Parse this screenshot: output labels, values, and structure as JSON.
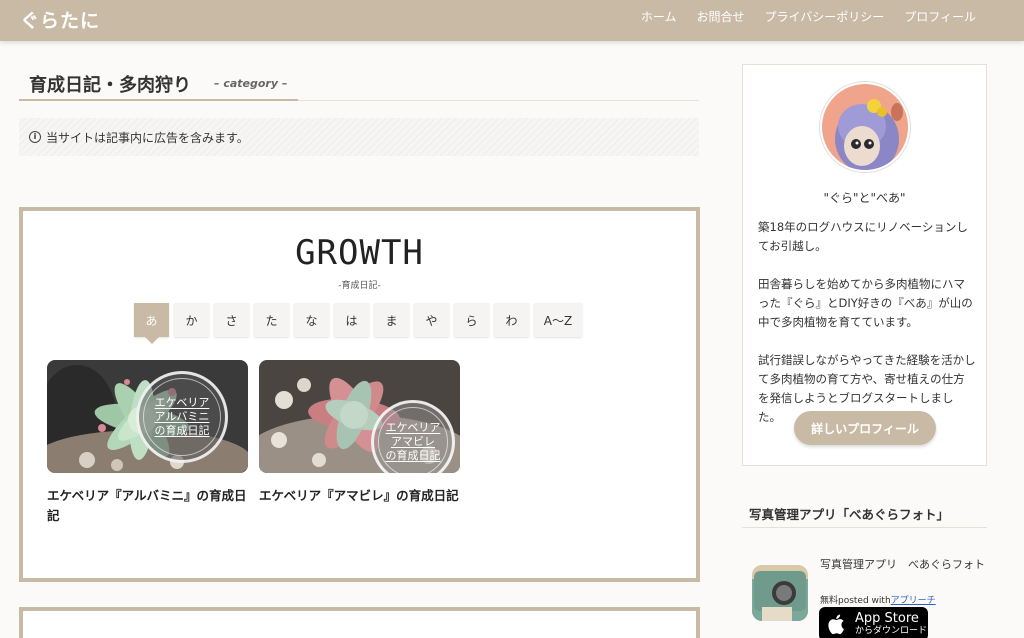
{
  "site": {
    "title": "ぐらたに"
  },
  "nav": [
    {
      "label": "ホーム"
    },
    {
      "label": "お問合せ"
    },
    {
      "label": "プライバシーポリシー"
    },
    {
      "label": "プロフィール"
    }
  ],
  "category": {
    "title": "育成日記・多肉狩り",
    "subtitle": "– category –"
  },
  "notice": {
    "icon": "info-icon",
    "text": "当サイトは記事内に広告を含みます。"
  },
  "growth": {
    "title": "GROWTH",
    "subtitle": "-育成日記-",
    "kana_tabs": [
      {
        "label": "あ",
        "active": true
      },
      {
        "label": "か"
      },
      {
        "label": "さ"
      },
      {
        "label": "た"
      },
      {
        "label": "な"
      },
      {
        "label": "は"
      },
      {
        "label": "ま"
      },
      {
        "label": "や"
      },
      {
        "label": "ら"
      },
      {
        "label": "わ"
      },
      {
        "label": "A〜Z"
      }
    ],
    "cards": [
      {
        "badge": [
          "エケベリア",
          "アルバミニ",
          "の育成日記"
        ],
        "title": "エケベリア『アルバミニ』の育成日記"
      },
      {
        "badge": [
          "エケベリア",
          "アマビレ",
          "の育成日記"
        ],
        "title": "エケベリア『アマビレ』の育成日記"
      }
    ]
  },
  "profile": {
    "name": "\"ぐら\"と\"べあ\"",
    "paragraphs": [
      "築18年のログハウスにリノベーションしてお引越し。",
      "田舎暮らしを始めてから多肉植物にハマった『ぐら』とDIY好きの『べあ』が山の中で多肉植物を育てています。",
      "試行錯誤しながらやってきた経験を活かして多肉植物の育て方や、寄せ植えの仕方を発信しようとブログスタートしました。"
    ],
    "button_label": "詳しいプロフィール"
  },
  "app": {
    "heading": "写真管理アプリ「べあぐらフォト」",
    "name": "写真管理アプリ　べあぐらフォト",
    "meta_prefix": "無料posted with",
    "meta_link": "アプリーチ",
    "store_small": "からダウンロード",
    "store_big": "App Store"
  },
  "colors": {
    "accent": "#c9baa6",
    "link": "#2d5fc2"
  }
}
